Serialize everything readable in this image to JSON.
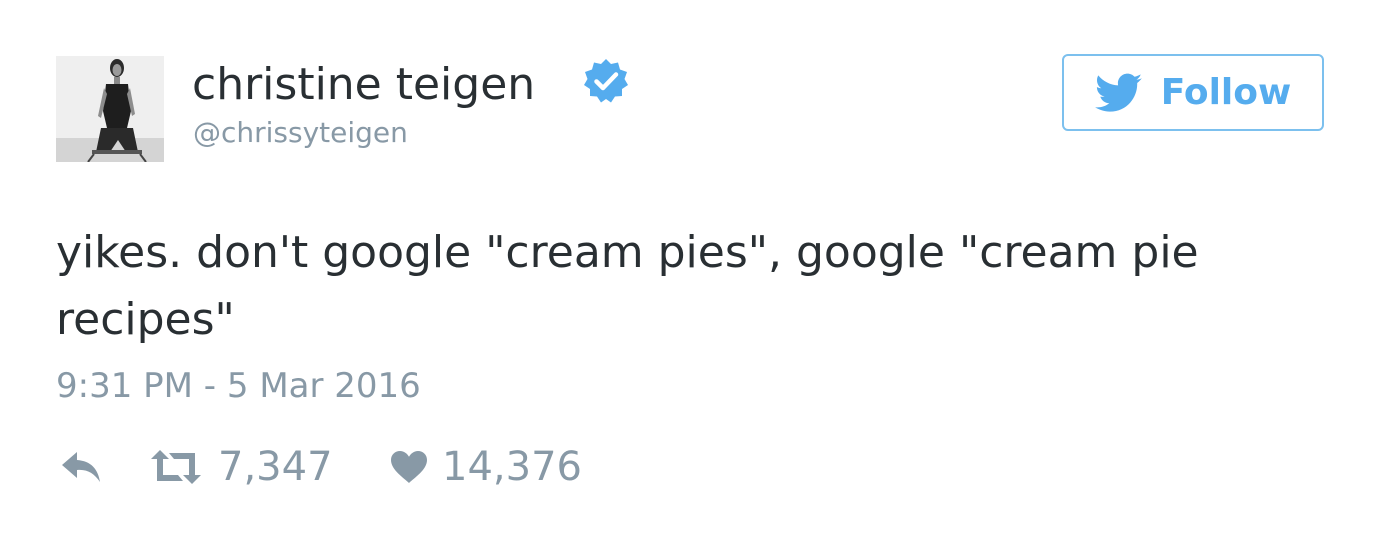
{
  "user": {
    "display_name": "christine teigen",
    "username": "@chrissyteigen",
    "verified": true,
    "verified_icon": "verified-badge-icon"
  },
  "follow_button": {
    "label": "Follow",
    "icon": "twitter-bird-icon"
  },
  "tweet": {
    "text": "yikes. don't google \"cream pies\", google \"cream pie\nrecipes\"",
    "timestamp": "9:31 PM - 5 Mar 2016"
  },
  "actions": {
    "reply": {
      "icon": "reply-icon"
    },
    "retweet": {
      "icon": "retweet-icon",
      "count": "7,347"
    },
    "like": {
      "icon": "heart-icon",
      "count": "14,376"
    }
  },
  "colors": {
    "text": "#292f33",
    "muted": "#8899a6",
    "accent": "#55acee",
    "border": "#7cc0ee"
  }
}
